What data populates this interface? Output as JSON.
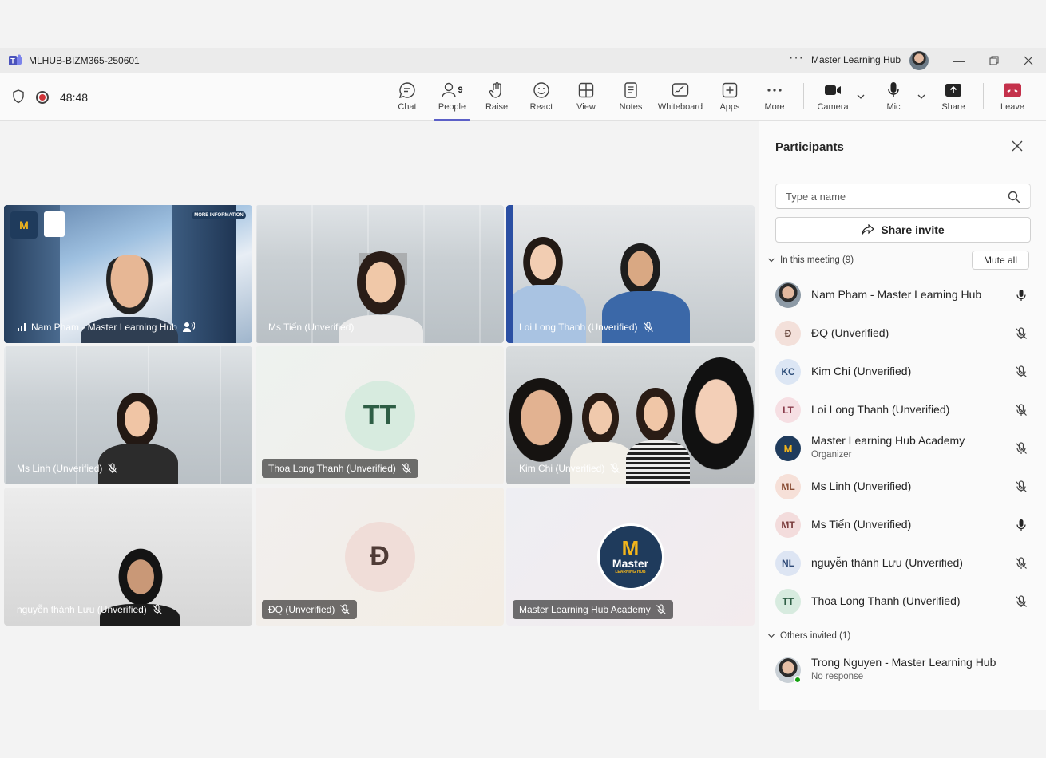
{
  "window": {
    "title": "MLHUB-BIZM365-250601",
    "org": "Master Learning Hub",
    "more": "···"
  },
  "toolbar": {
    "timer": "48:48",
    "buttons": [
      {
        "id": "chat",
        "label": "Chat",
        "icon": "chat-icon"
      },
      {
        "id": "people",
        "label": "People",
        "icon": "people-icon",
        "count": "9"
      },
      {
        "id": "raise",
        "label": "Raise",
        "icon": "raise-hand-icon"
      },
      {
        "id": "react",
        "label": "React",
        "icon": "smiley-icon"
      },
      {
        "id": "view",
        "label": "View",
        "icon": "grid-icon"
      },
      {
        "id": "notes",
        "label": "Notes",
        "icon": "notes-icon"
      },
      {
        "id": "whiteboard",
        "label": "Whiteboard",
        "icon": "whiteboard-icon"
      },
      {
        "id": "apps",
        "label": "Apps",
        "icon": "apps-icon"
      },
      {
        "id": "more",
        "label": "More",
        "icon": "more-icon"
      },
      {
        "id": "camera",
        "label": "Camera",
        "icon": "camera-icon"
      },
      {
        "id": "mic",
        "label": "Mic",
        "icon": "mic-icon"
      },
      {
        "id": "share",
        "label": "Share",
        "icon": "share-icon"
      },
      {
        "id": "leave",
        "label": "Leave",
        "icon": "hangup-icon"
      }
    ],
    "accent": "#5b5fc7",
    "leave_color": "#c4314b"
  },
  "tiles": [
    {
      "name": "Nam Pham - Master Learning Hub",
      "type": "video"
    },
    {
      "name": "Ms Tiến (Unverified)",
      "type": "video"
    },
    {
      "name": "Loi Long Thanh (Unverified)",
      "type": "video"
    },
    {
      "name": "Ms Linh (Unverified)",
      "type": "video"
    },
    {
      "name": "Thoa Long Thanh (Unverified)",
      "type": "avatar",
      "initials": "TT"
    },
    {
      "name": "Kim Chi (Unverified)",
      "type": "video"
    },
    {
      "name": "nguyễn thành Lưu (Unverified)",
      "type": "video"
    },
    {
      "name": "ĐQ (Unverified)",
      "type": "avatar",
      "initials": "Đ"
    },
    {
      "name": "Master Learning Hub Academy",
      "type": "logo",
      "logo_text": "Master",
      "logo_sub": "LEARNING HUB"
    }
  ],
  "tile_extras": {
    "more_info": "MORE INFORMATION"
  },
  "panel": {
    "title": "Participants",
    "search_placeholder": "Type a name",
    "share_invite": "Share invite",
    "in_meeting_label": "In this meeting (9)",
    "mute_all": "Mute all",
    "others_label": "Others invited (1)",
    "participants": [
      {
        "name": "Nam Pham - Master Learning Hub",
        "initials": "",
        "mic": "on"
      },
      {
        "name": "ĐQ (Unverified)",
        "initials": "Đ",
        "mic": "off"
      },
      {
        "name": "Kim Chi (Unverified)",
        "initials": "KC",
        "mic": "off"
      },
      {
        "name": "Loi Long Thanh (Unverified)",
        "initials": "LT",
        "mic": "off"
      },
      {
        "name": "Master Learning Hub Academy",
        "initials": "",
        "sub": "Organizer",
        "mic": "off"
      },
      {
        "name": "Ms Linh (Unverified)",
        "initials": "ML",
        "mic": "off"
      },
      {
        "name": "Ms Tiến (Unverified)",
        "initials": "MT",
        "mic": "on"
      },
      {
        "name": "nguyễn thành Lưu (Unverified)",
        "initials": "NL",
        "mic": "off"
      },
      {
        "name": "Thoa Long Thanh (Unverified)",
        "initials": "TT",
        "mic": "off"
      }
    ],
    "invited": [
      {
        "name": "Trong Nguyen - Master Learning Hub",
        "sub": "No response"
      }
    ]
  }
}
